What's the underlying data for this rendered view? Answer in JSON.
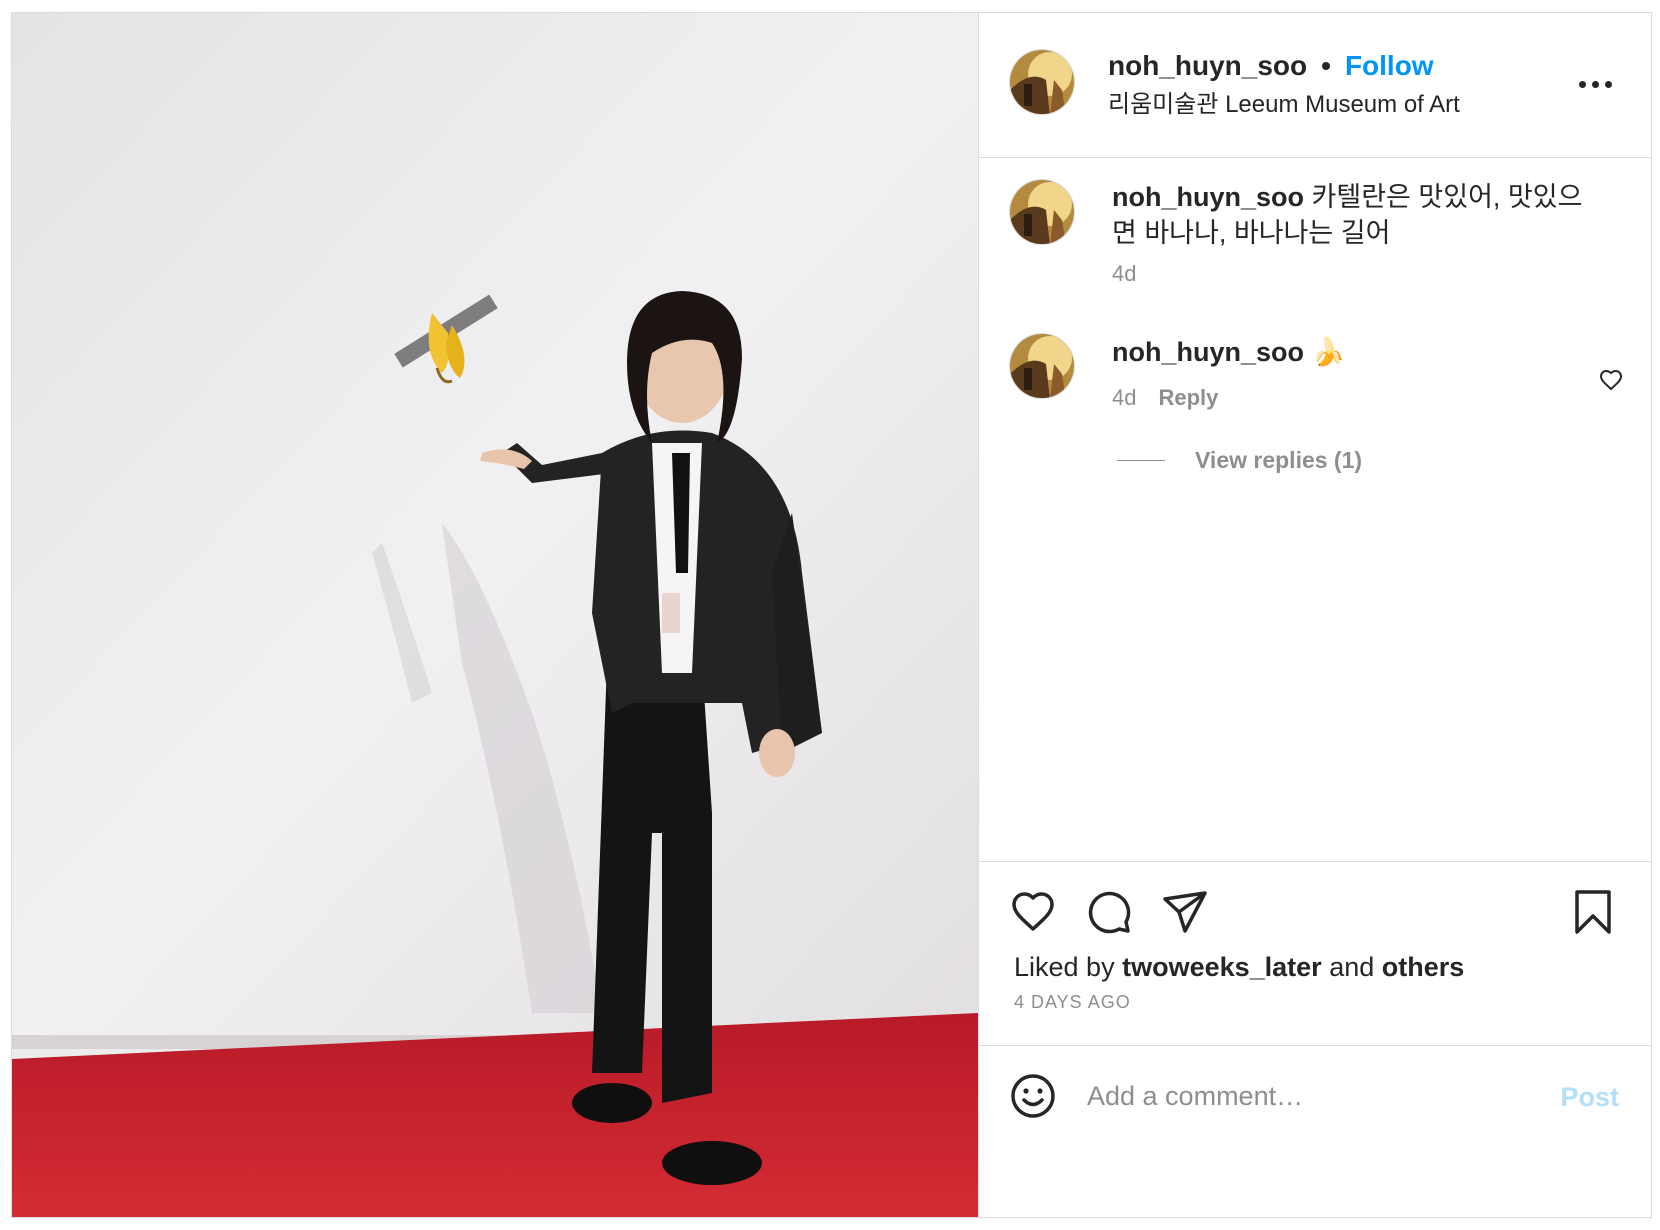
{
  "post": {
    "image_alt": "Man in black cardigan pointing at a banana duct-taped to a white wall above a red carpet",
    "author": {
      "username": "noh_huyn_soo",
      "follow_label": "Follow",
      "location": "리움미술관 Leeum Museum of Art",
      "separator": "•"
    },
    "caption": {
      "username": "noh_huyn_soo",
      "text": "카텔란은 맛있어, 맛있으면 바나나, 바나나는 길어",
      "age": "4d"
    },
    "comments": [
      {
        "username": "noh_huyn_soo",
        "text": "🍌",
        "age": "4d",
        "reply_label": "Reply",
        "view_replies": "View replies (1)"
      }
    ],
    "likes": {
      "prefix": "Liked by",
      "user": "twoweeks_later",
      "conjunction": "and",
      "others": "others"
    },
    "timestamp": "4 DAYS AGO",
    "composer": {
      "placeholder": "Add a comment…",
      "post_label": "Post"
    },
    "colors": {
      "accent": "#0095f6",
      "post_disabled": "#b2dffc",
      "text": "#262626",
      "muted": "#8e8e8e",
      "carpet": "#c9202c"
    },
    "icons": [
      "more-icon",
      "heart-icon",
      "comment-icon",
      "share-icon",
      "bookmark-icon",
      "emoji-icon",
      "small-heart-icon"
    ]
  }
}
